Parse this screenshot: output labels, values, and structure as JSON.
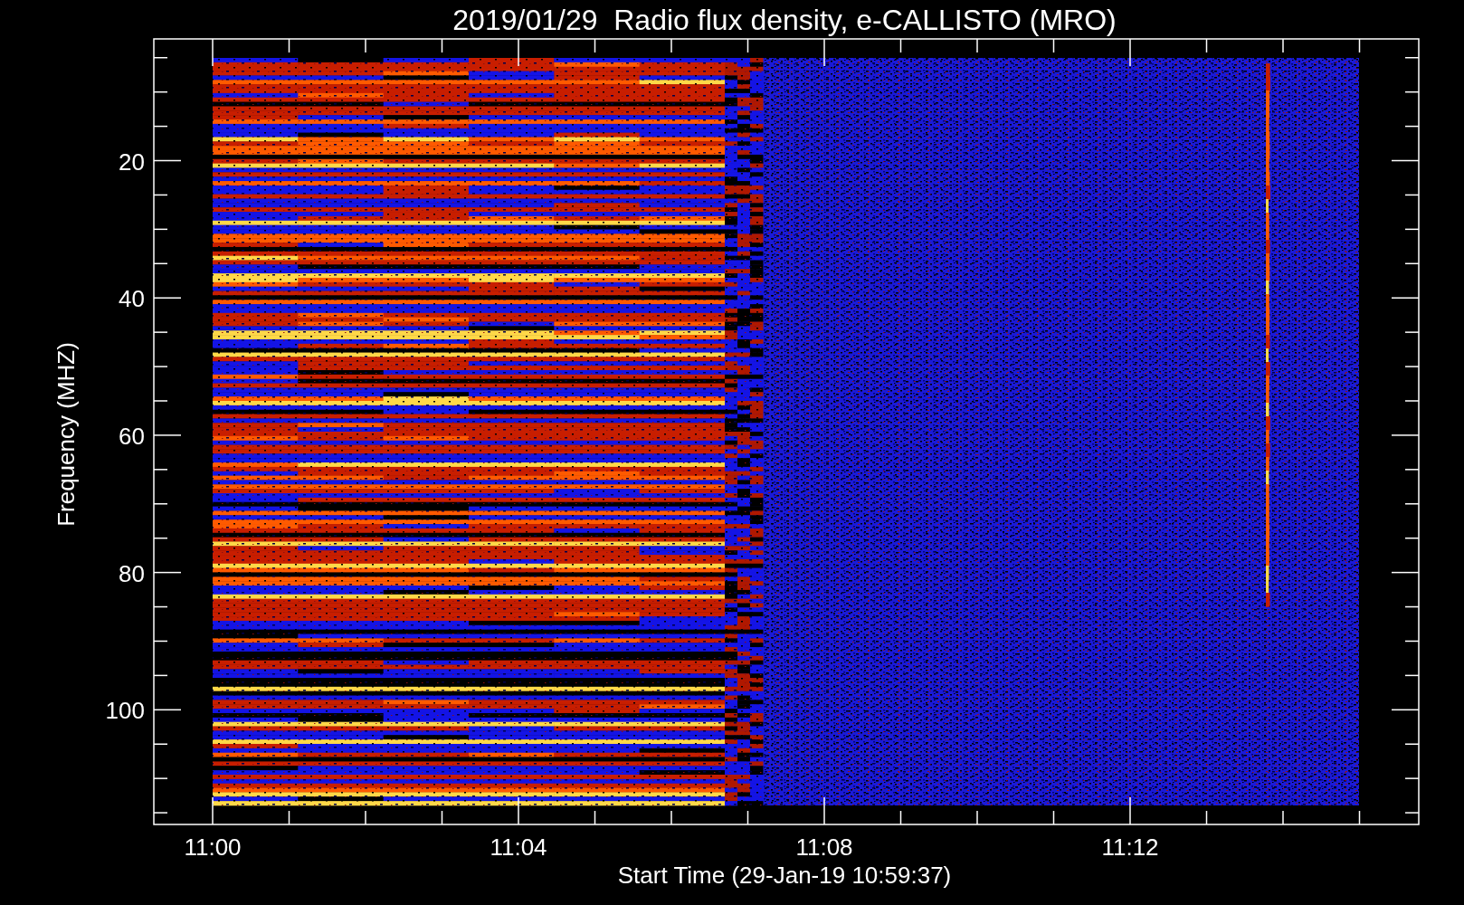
{
  "title": "2019/01/29  Radio flux density, e-CALLISTO (MRO)",
  "chart": {
    "xlabel": "Start Time (29-Jan-19 10:59:37)",
    "ylabel": "Frequency (MHZ)",
    "xticks": [
      {
        "label": "11:00"
      },
      {
        "label": "11:04"
      },
      {
        "label": "11:08"
      },
      {
        "label": "11:12"
      }
    ],
    "yticks": [
      {
        "label": "20"
      },
      {
        "label": "40"
      },
      {
        "label": "60"
      },
      {
        "label": "80"
      },
      {
        "label": "100"
      }
    ]
  }
}
